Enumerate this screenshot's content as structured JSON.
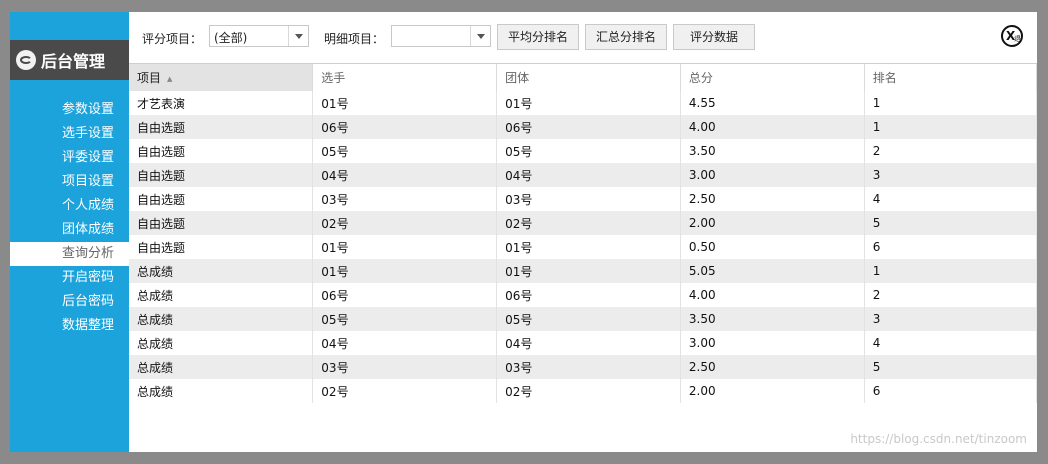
{
  "sidebar": {
    "brand_title": "后台管理",
    "items": [
      {
        "label": "参数设置"
      },
      {
        "label": "选手设置"
      },
      {
        "label": "评委设置"
      },
      {
        "label": "项目设置"
      },
      {
        "label": "个人成绩"
      },
      {
        "label": "团体成绩"
      },
      {
        "label": "查询分析",
        "active": true
      },
      {
        "label": "开启密码"
      },
      {
        "label": "后台密码"
      },
      {
        "label": "数据整理"
      }
    ]
  },
  "toolbar": {
    "score_item_label": "评分项目：",
    "score_item_value": "(全部)",
    "detail_item_label": "明细项目：",
    "detail_item_value": "",
    "avg_rank_button": "平均分排名",
    "total_rank_button": "汇总分排名",
    "score_data_button": "评分数据"
  },
  "close_icon": {
    "glyph": "X",
    "sub": "退"
  },
  "table": {
    "columns": [
      "项目",
      "选手",
      "团体",
      "总分",
      "排名"
    ],
    "sorted_column": "项目",
    "rows": [
      [
        "才艺表演",
        "01号",
        "01号",
        "4.55",
        "1"
      ],
      [
        "自由选题",
        "06号",
        "06号",
        "4.00",
        "1"
      ],
      [
        "自由选题",
        "05号",
        "05号",
        "3.50",
        "2"
      ],
      [
        "自由选题",
        "04号",
        "04号",
        "3.00",
        "3"
      ],
      [
        "自由选题",
        "03号",
        "03号",
        "2.50",
        "4"
      ],
      [
        "自由选题",
        "02号",
        "02号",
        "2.00",
        "5"
      ],
      [
        "自由选题",
        "01号",
        "01号",
        "0.50",
        "6"
      ],
      [
        "总成绩",
        "01号",
        "01号",
        "5.05",
        "1"
      ],
      [
        "总成绩",
        "06号",
        "06号",
        "4.00",
        "2"
      ],
      [
        "总成绩",
        "05号",
        "05号",
        "3.50",
        "3"
      ],
      [
        "总成绩",
        "04号",
        "04号",
        "3.00",
        "4"
      ],
      [
        "总成绩",
        "03号",
        "03号",
        "2.50",
        "5"
      ],
      [
        "总成绩",
        "02号",
        "02号",
        "2.00",
        "6"
      ]
    ]
  },
  "watermark": "https://blog.csdn.net/tinzoom"
}
